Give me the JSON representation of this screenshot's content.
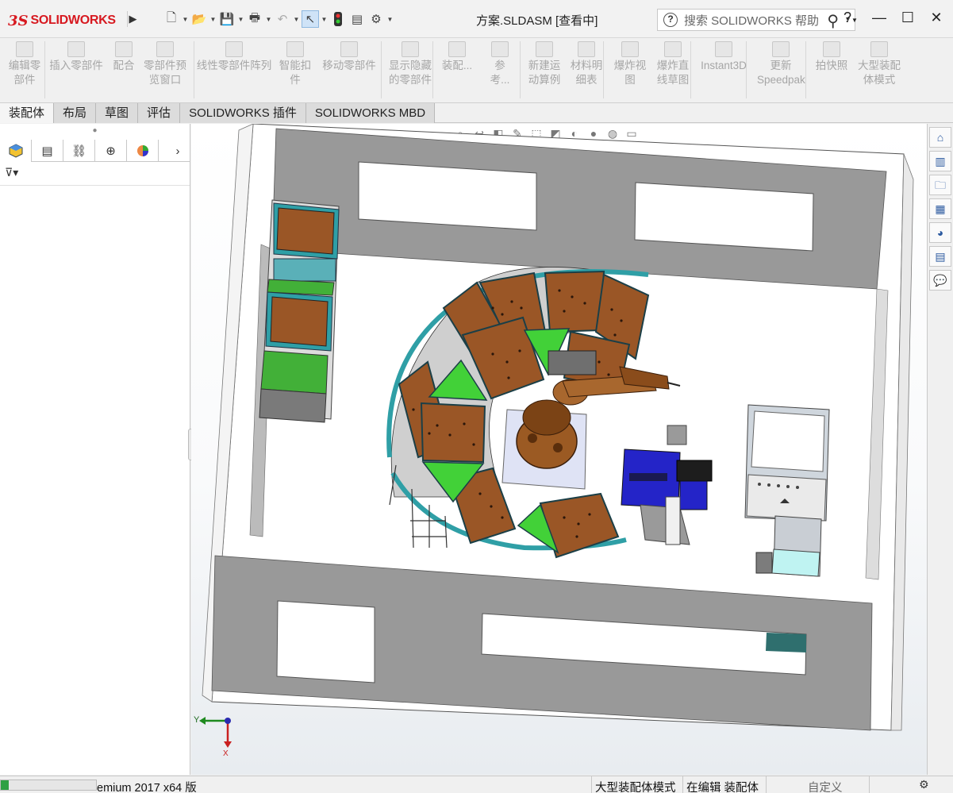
{
  "app": {
    "logo_ds": "3S",
    "logo_text": "SOLIDWORKS",
    "document_title": "方案.SLDASM [查看中]"
  },
  "help_search": {
    "placeholder": "搜索 SOLIDWORKS 帮助",
    "help_label": "?"
  },
  "ribbon": {
    "buttons": [
      {
        "label": "编辑零部件",
        "line1": "编辑零",
        "line2": "部件"
      },
      {
        "label": "插入零部件",
        "line1": "插入零部件",
        "line2": ""
      },
      {
        "label": "配合",
        "line1": "配合",
        "line2": ""
      },
      {
        "label": "零部件预览窗口",
        "line1": "零部件预",
        "line2": "览窗口"
      },
      {
        "label": "线性零部件阵列",
        "line1": "线性零部件阵列",
        "line2": ""
      },
      {
        "label": "智能扣件",
        "line1": "智能扣",
        "line2": "件"
      },
      {
        "label": "移动零部件",
        "line1": "移动零部件",
        "line2": ""
      },
      {
        "label": "显示隐藏的零部件",
        "line1": "显示隐藏",
        "line2": "的零部件"
      },
      {
        "label": "装配...",
        "line1": "装配...",
        "line2": ""
      },
      {
        "label": "参考...",
        "line1": "参考...",
        "line2": ""
      },
      {
        "label": "新建运动算例",
        "line1": "新建运",
        "line2": "动算例"
      },
      {
        "label": "材料明细表",
        "line1": "材料明",
        "line2": "细表"
      },
      {
        "label": "爆炸视图",
        "line1": "爆炸视",
        "line2": "图"
      },
      {
        "label": "爆炸直线草图",
        "line1": "爆炸直",
        "line2": "线草图"
      },
      {
        "label": "Instant3D",
        "line1": "Instant3D",
        "line2": ""
      },
      {
        "label": "更新Speedpak",
        "line1": "更新",
        "line2": "Speedpak"
      },
      {
        "label": "拍快照",
        "line1": "拍快照",
        "line2": ""
      },
      {
        "label": "大型装配体模式",
        "line1": "大型装配",
        "line2": "体模式"
      }
    ]
  },
  "tabs": [
    {
      "label": "装配体",
      "active": true
    },
    {
      "label": "布局",
      "active": false
    },
    {
      "label": "草图",
      "active": false
    },
    {
      "label": "评估",
      "active": false
    },
    {
      "label": "SOLIDWORKS 插件",
      "active": false
    },
    {
      "label": "SOLIDWORKS MBD",
      "active": false
    }
  ],
  "left_panel": {
    "filter_icon": "filter-icon"
  },
  "axis_triad": {
    "y_label": "Y",
    "x_label": "X"
  },
  "status_bar": {
    "product": "emium 2017 x64 版",
    "mode": "大型装配体模式",
    "editing": "在编辑 装配体",
    "custom": "自定义"
  },
  "colors": {
    "wall": "#999999",
    "floor": "#ffffff",
    "panel_wood": "#9a5626",
    "panel_green": "#42d138",
    "frame_teal": "#2f9fa6",
    "robot": "#9b5a23",
    "machine_blue": "#2424c8"
  }
}
